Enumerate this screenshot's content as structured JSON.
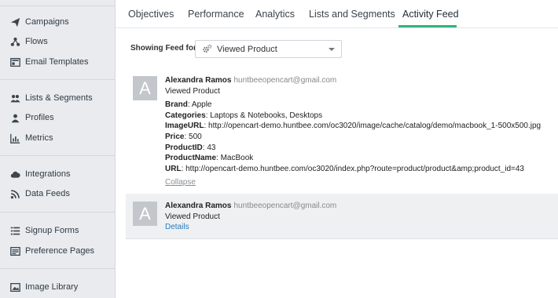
{
  "sidebar": {
    "items": [
      {
        "label": "Campaigns",
        "icon": "paper-plane-icon"
      },
      {
        "label": "Flows",
        "icon": "flow-icon"
      },
      {
        "label": "Email Templates",
        "icon": "email-template-icon"
      },
      {
        "label": "Lists & Segments",
        "icon": "users-icon"
      },
      {
        "label": "Profiles",
        "icon": "user-icon"
      },
      {
        "label": "Metrics",
        "icon": "bar-chart-icon"
      },
      {
        "label": "Integrations",
        "icon": "cloud-icon"
      },
      {
        "label": "Data Feeds",
        "icon": "rss-icon"
      },
      {
        "label": "Signup Forms",
        "icon": "form-icon"
      },
      {
        "label": "Preference Pages",
        "icon": "preference-icon"
      },
      {
        "label": "Image Library",
        "icon": "image-icon"
      }
    ]
  },
  "tabs": [
    "Objectives",
    "Performance",
    "Analytics",
    "Lists and Segments",
    "Activity Feed"
  ],
  "active_tab": "Activity Feed",
  "filter": {
    "label": "Showing Feed for",
    "selected": "Viewed Product"
  },
  "feed": [
    {
      "avatar": "A",
      "name": "Alexandra Ramos",
      "email": "huntbeeopencart@gmail.com",
      "event": "Viewed Product",
      "properties": [
        {
          "key": "Brand",
          "value": "Apple"
        },
        {
          "key": "Categories",
          "value": "Laptops & Notebooks, Desktops"
        },
        {
          "key": "ImageURL",
          "value": "http://opencart-demo.huntbee.com/oc3020/image/cache/catalog/demo/macbook_1-500x500.jpg"
        },
        {
          "key": "Price",
          "value": "500"
        },
        {
          "key": "ProductID",
          "value": "43"
        },
        {
          "key": "ProductName",
          "value": "MacBook"
        },
        {
          "key": "URL",
          "value": "http://opencart-demo.huntbee.com/oc3020/index.php?route=product/product&amp;product_id=43"
        }
      ],
      "link": "Collapse"
    },
    {
      "avatar": "A",
      "name": "Alexandra Ramos",
      "email": "huntbeeopencart@gmail.com",
      "event": "Viewed Product",
      "link": "Details"
    }
  ],
  "colors": {
    "accent": "#2db77c",
    "link": "#2a7bbf",
    "sidebar_bg": "#e9ebee",
    "avatar_bg": "#c3c7cb"
  }
}
